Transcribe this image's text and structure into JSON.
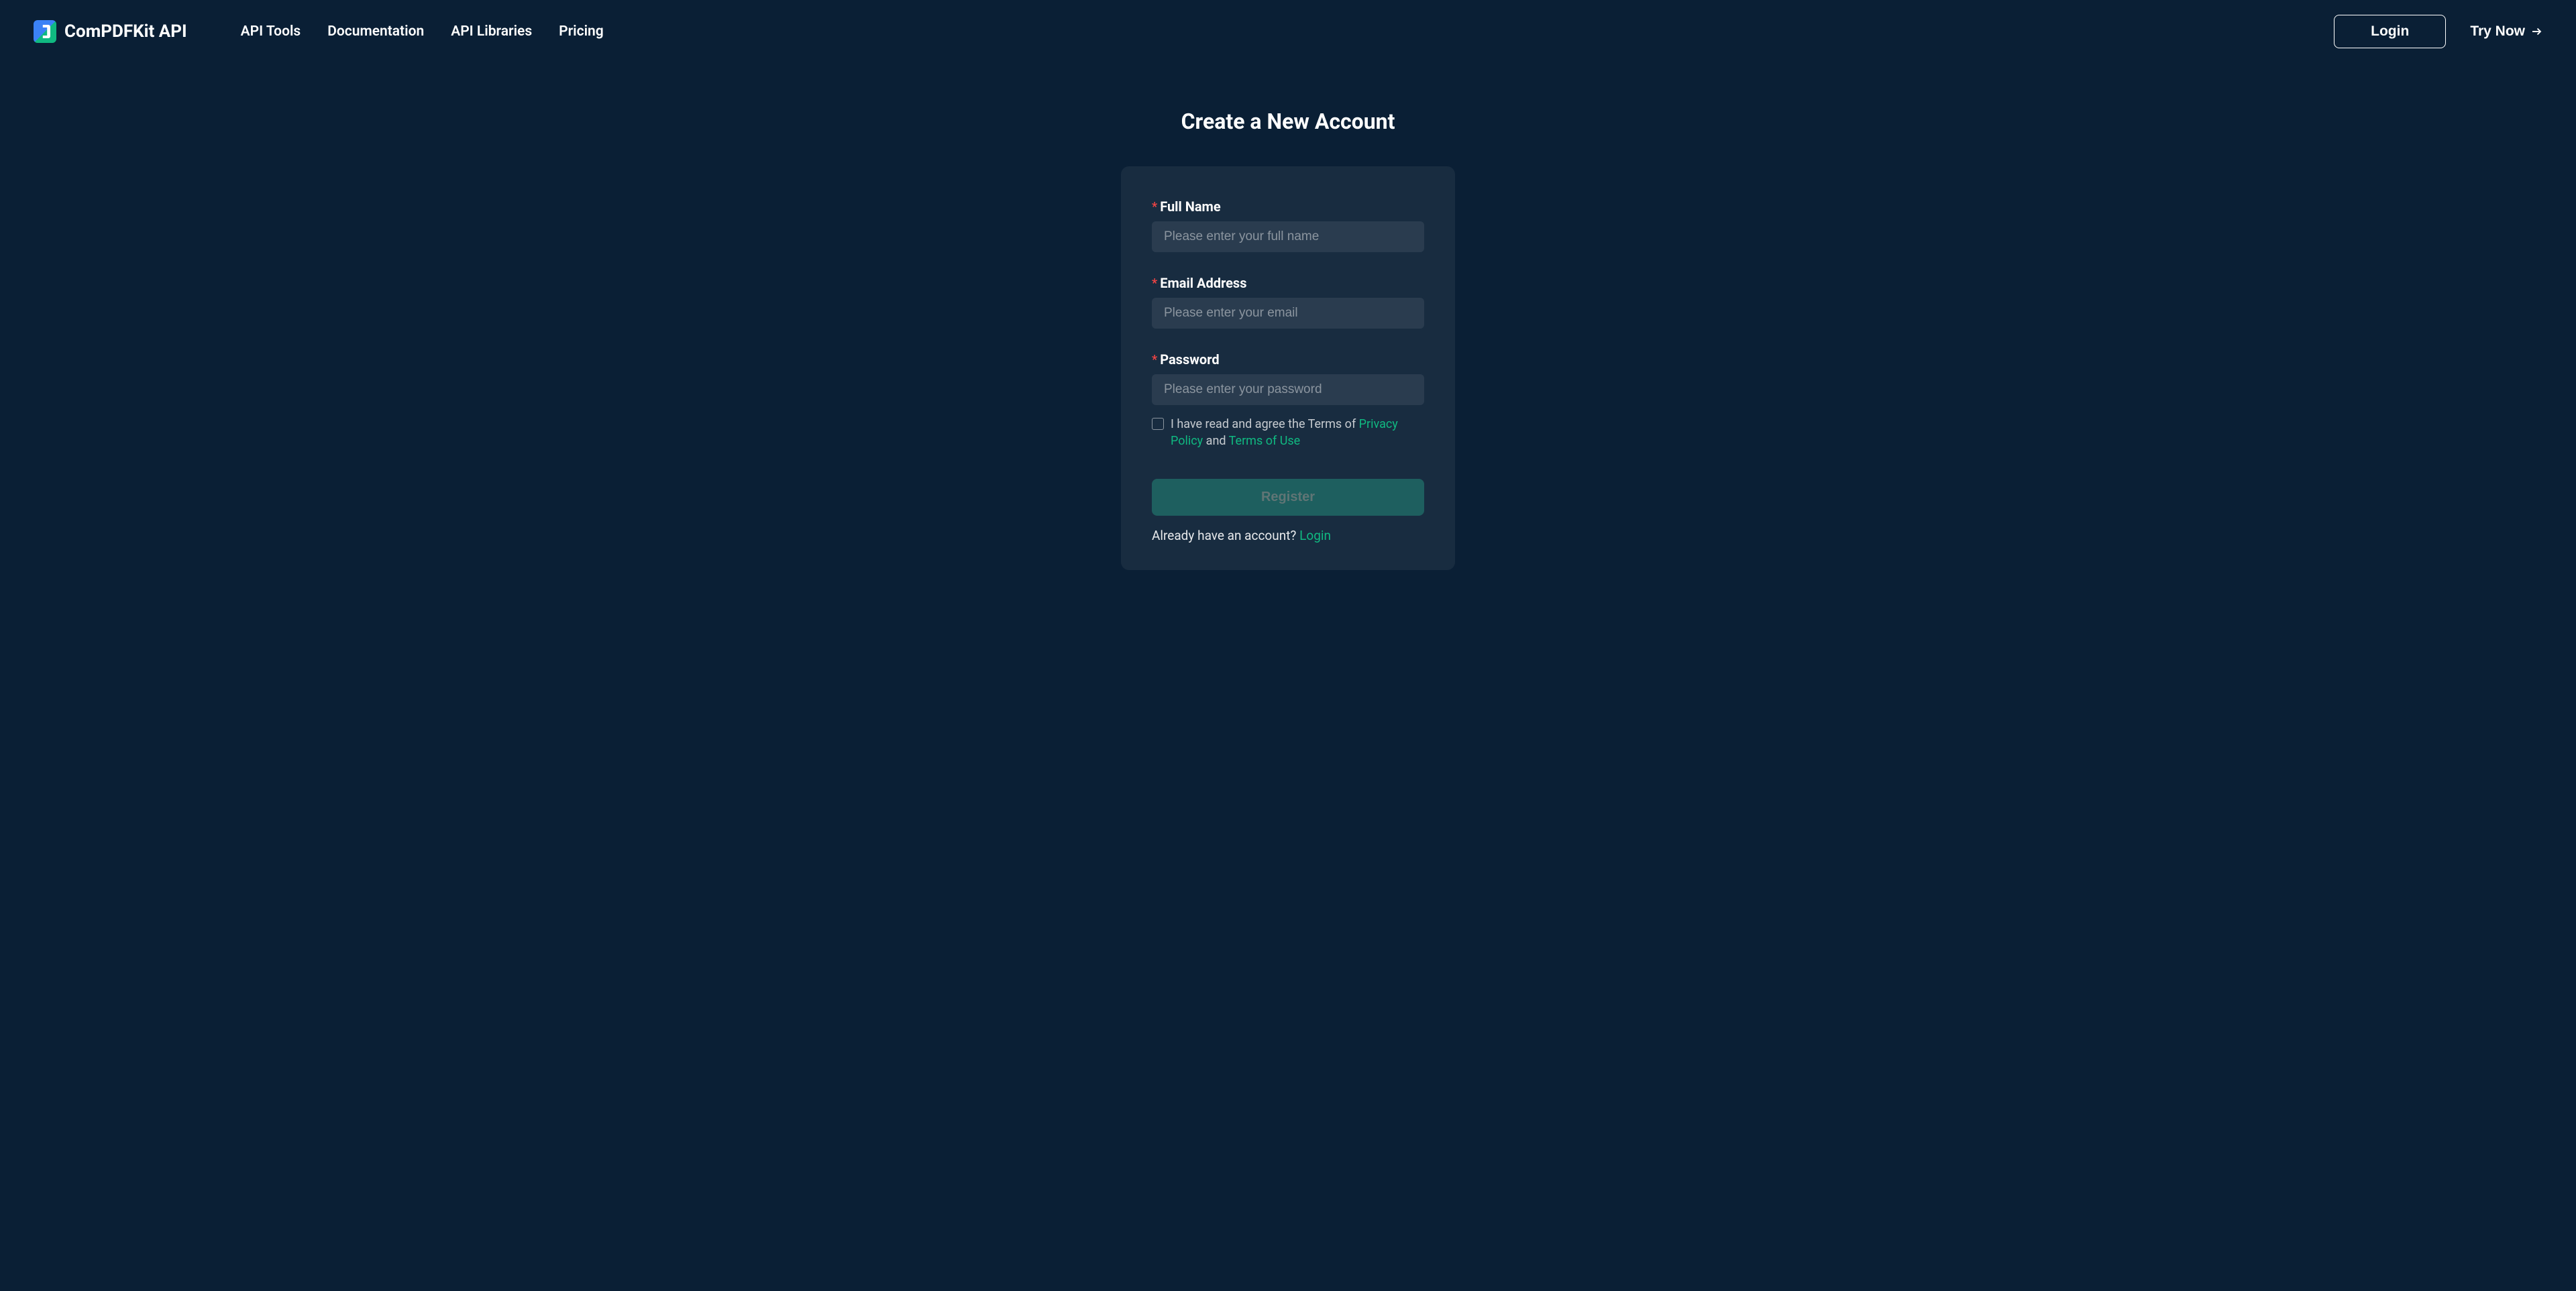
{
  "header": {
    "brand": "ComPDFKit API",
    "nav": {
      "api_tools": "API Tools",
      "documentation": "Documentation",
      "api_libraries": "API Libraries",
      "pricing": "Pricing"
    },
    "login_label": "Login",
    "try_now_label": "Try Now"
  },
  "main": {
    "title": "Create a New Account",
    "form": {
      "full_name": {
        "label": "Full Name",
        "placeholder": "Please enter your full name"
      },
      "email": {
        "label": "Email Address",
        "placeholder": "Please enter your email"
      },
      "password": {
        "label": "Password",
        "placeholder": "Please enter your password"
      },
      "terms": {
        "prefix": "I have read and agree the Terms of ",
        "privacy_policy": "Privacy Policy",
        "and": " and ",
        "terms_of_use": "Terms of Use"
      },
      "register_label": "Register",
      "login_prompt": "Already have an account? ",
      "login_link": "Login"
    }
  }
}
